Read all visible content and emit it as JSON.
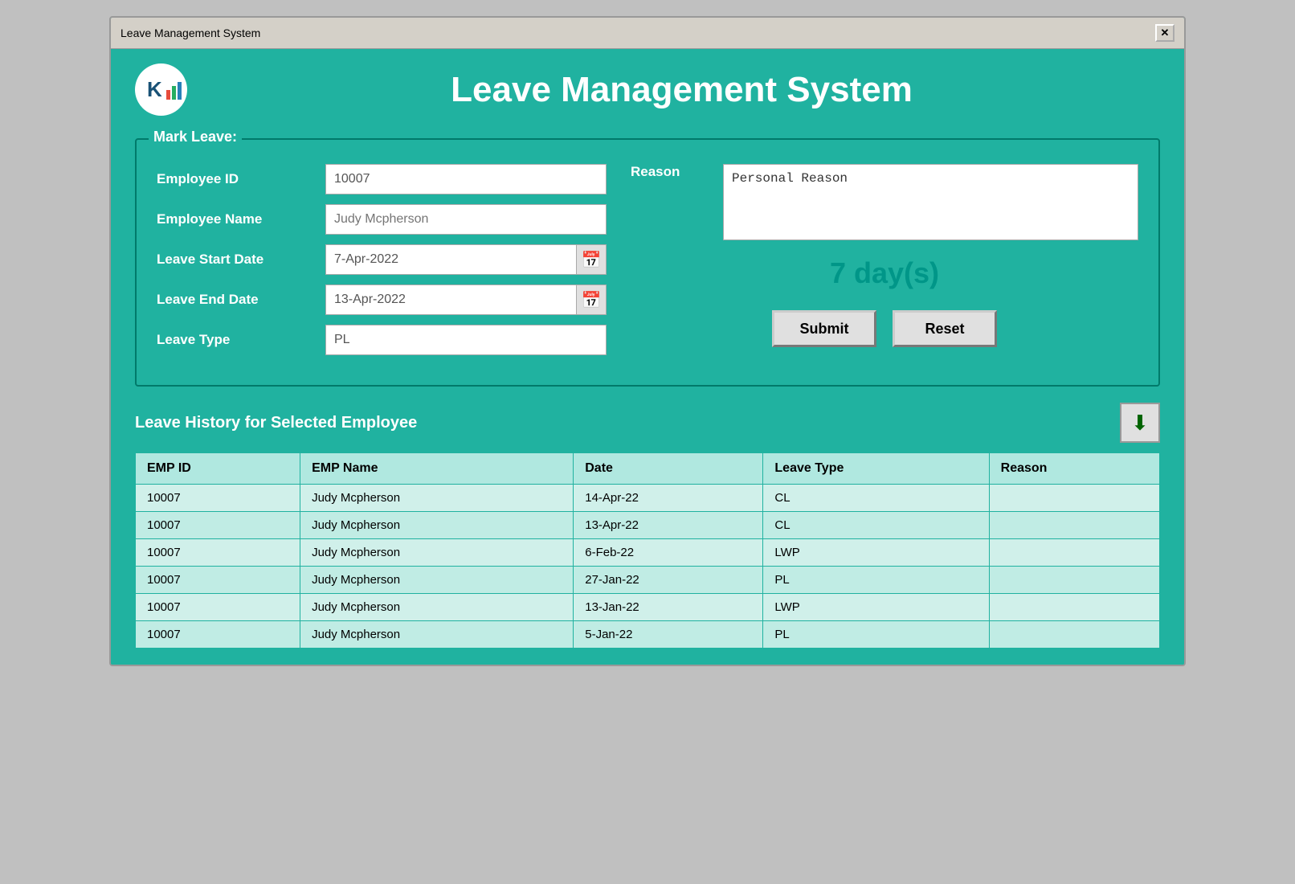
{
  "window": {
    "title": "Leave Management System",
    "close_label": "✕"
  },
  "header": {
    "title": "Leave Management System",
    "logo_text": "K"
  },
  "mark_leave": {
    "section_title": "Mark Leave:",
    "employee_id_label": "Employee ID",
    "employee_id_value": "10007",
    "employee_name_label": "Employee Name",
    "employee_name_placeholder": "Judy Mcpherson",
    "leave_start_label": "Leave Start Date",
    "leave_start_value": "7-Apr-2022",
    "leave_end_label": "Leave End Date",
    "leave_end_value": "13-Apr-2022",
    "leave_type_label": "Leave Type",
    "leave_type_value": "PL",
    "reason_label": "Reason",
    "reason_value": "Personal Reason",
    "days_display": "7 day(s)",
    "submit_label": "Submit",
    "reset_label": "Reset"
  },
  "history": {
    "section_title": "Leave History for Selected Employee",
    "columns": [
      "EMP ID",
      "EMP Name",
      "Date",
      "Leave Type",
      "Reason"
    ],
    "rows": [
      {
        "emp_id": "10007",
        "emp_name": "Judy Mcpherson",
        "date": "14-Apr-22",
        "leave_type": "CL",
        "reason": ""
      },
      {
        "emp_id": "10007",
        "emp_name": "Judy Mcpherson",
        "date": "13-Apr-22",
        "leave_type": "CL",
        "reason": ""
      },
      {
        "emp_id": "10007",
        "emp_name": "Judy Mcpherson",
        "date": "6-Feb-22",
        "leave_type": "LWP",
        "reason": ""
      },
      {
        "emp_id": "10007",
        "emp_name": "Judy Mcpherson",
        "date": "27-Jan-22",
        "leave_type": "PL",
        "reason": ""
      },
      {
        "emp_id": "10007",
        "emp_name": "Judy Mcpherson",
        "date": "13-Jan-22",
        "leave_type": "LWP",
        "reason": ""
      },
      {
        "emp_id": "10007",
        "emp_name": "Judy Mcpherson",
        "date": "5-Jan-22",
        "leave_type": "PL",
        "reason": ""
      }
    ]
  }
}
